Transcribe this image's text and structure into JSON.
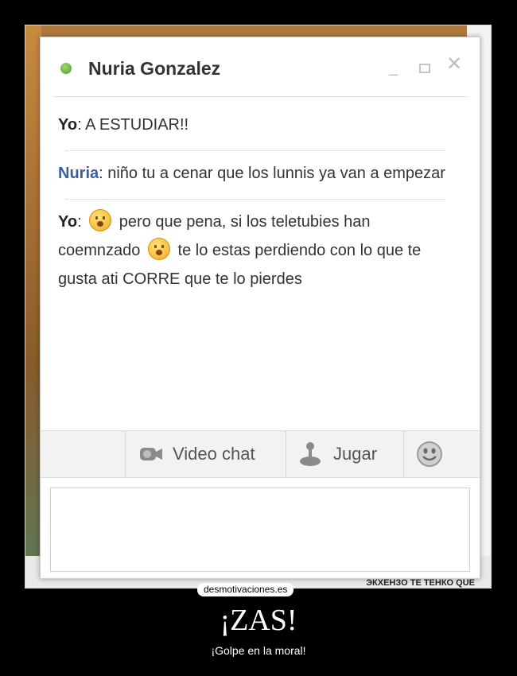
{
  "chat": {
    "contact_name": "Nuria Gonzalez",
    "status_color": "#5aa632",
    "messages": [
      {
        "sender": "Yo",
        "text": ": A ESTUDIAR!!"
      },
      {
        "sender": "Nuria",
        "text": ": niño tu a cenar que los lunnis ya van a empezar"
      },
      {
        "sender": "Yo",
        "part1": "pero que pena, si los teletubies han coemnzado",
        "part2": "te lo estas perdiendo con lo que te gusta ati CORRE que te lo pierdes"
      }
    ],
    "toolbar": {
      "video_label": "Video chat",
      "game_label": "Jugar",
      "video_icon": "video-camera-icon",
      "game_icon": "joystick-icon",
      "emoticon_icon": "smiley-icon"
    },
    "input_placeholder": ""
  },
  "background_snippet": "ЭКХЕНЗО ТЕ ТЕНКО QUE",
  "poster": {
    "brand": "desmotivaciones.es",
    "title": "¡ZAS!",
    "subtitle": "¡Golpe en la moral!"
  }
}
